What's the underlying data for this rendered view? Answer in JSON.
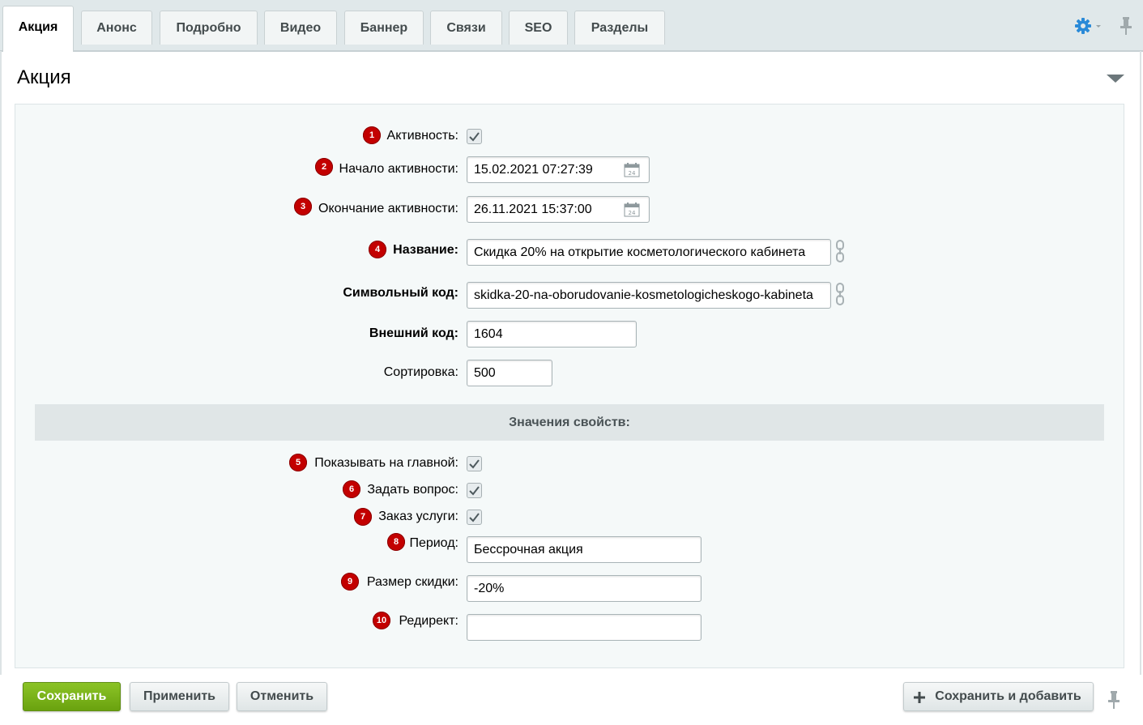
{
  "tabs": [
    {
      "label": "Акция",
      "active": true
    },
    {
      "label": "Анонс"
    },
    {
      "label": "Подробно"
    },
    {
      "label": "Видео"
    },
    {
      "label": "Баннер"
    },
    {
      "label": "Связи"
    },
    {
      "label": "SEO"
    },
    {
      "label": "Разделы"
    }
  ],
  "toolbar_icons": {
    "settings": "gear-icon",
    "pin": "pin-icon"
  },
  "section": {
    "title": "Акция"
  },
  "fields": {
    "active": {
      "badge": "1",
      "label": "Активность:",
      "checked": true
    },
    "start": {
      "badge": "2",
      "label": "Начало активности:",
      "value": "15.02.2021 07:27:39"
    },
    "end": {
      "badge": "3",
      "label": "Окончание активности:",
      "value": "26.11.2021 15:37:00"
    },
    "name": {
      "badge": "4",
      "label": "Название:",
      "value": "Скидка 20% на открытие косметологического кабинета"
    },
    "code": {
      "label": "Символьный код:",
      "value": "skidka-20-na-oborudovanie-kosmetologicheskogo-kabineta"
    },
    "external": {
      "label": "Внешний код:",
      "value": "1604"
    },
    "sort": {
      "label": "Сортировка:",
      "value": "500"
    }
  },
  "props": {
    "header": "Значения свойств:",
    "show_main": {
      "badge": "5",
      "label": "Показывать на главной:",
      "checked": true
    },
    "ask": {
      "badge": "6",
      "label": "Задать вопрос:",
      "checked": true
    },
    "order": {
      "badge": "7",
      "label": "Заказ услуги:",
      "checked": true
    },
    "period": {
      "badge": "8",
      "label": "Период:",
      "value": "Бессрочная акция"
    },
    "discount": {
      "badge": "9",
      "label": "Размер скидки:",
      "value": "-20%"
    },
    "redirect": {
      "badge": "10",
      "label": "Редирект:",
      "value": ""
    }
  },
  "buttons": {
    "save": "Сохранить",
    "apply": "Применить",
    "cancel": "Отменить",
    "save_add": "Сохранить и добавить"
  },
  "colors": {
    "badge": "#c30000",
    "save_button": "#7ab31a",
    "tabbar": "#e0e8ea"
  }
}
